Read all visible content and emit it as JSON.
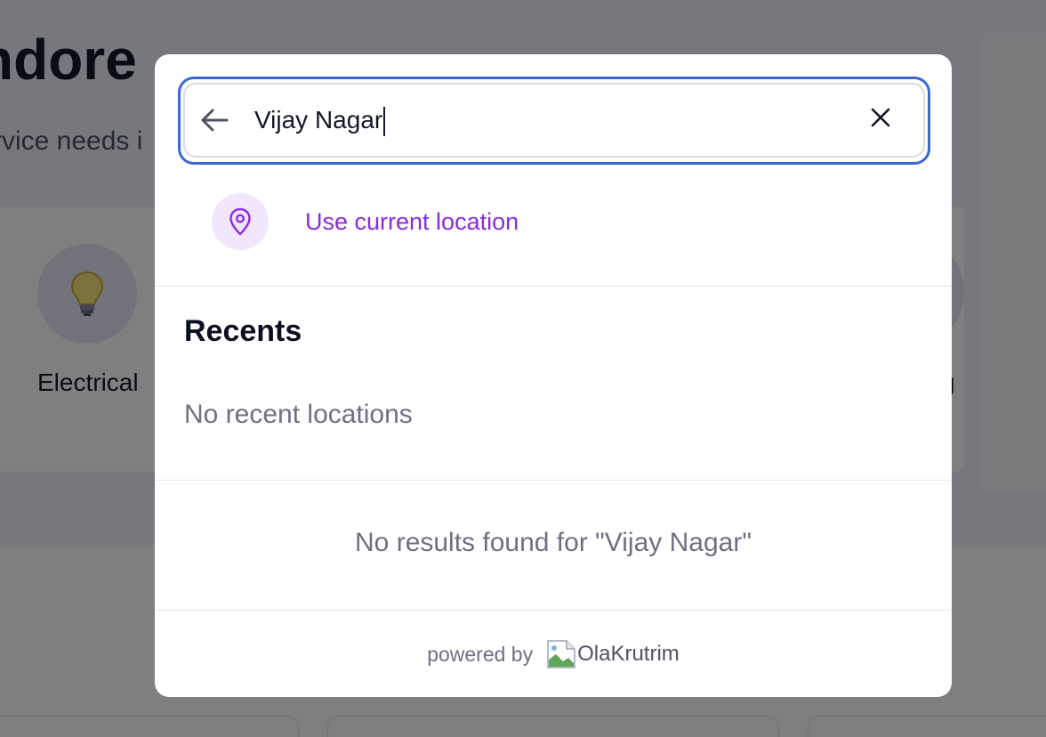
{
  "background": {
    "title": "ndore",
    "subtitle": "rvice needs i",
    "categories": [
      {
        "label": "Electrical",
        "icon": "lightbulb-icon"
      },
      {
        "label": "g"
      }
    ]
  },
  "search": {
    "value": "Vijay Nagar",
    "back_icon": "arrow-left-icon",
    "clear_icon": "close-icon"
  },
  "current_location": {
    "label": "Use current location",
    "icon": "map-pin-icon",
    "color": "#8a2be2"
  },
  "recents": {
    "title": "Recents",
    "empty_text": "No recent locations"
  },
  "results": {
    "empty_text": "No results found for \"Vijay Nagar\""
  },
  "footer": {
    "powered_by": "powered by",
    "brand": "OlaKrutrim"
  },
  "colors": {
    "focus_ring": "#3b67d8",
    "accent": "#8a2be2",
    "overlay": "rgba(0,0,0,0.5)"
  }
}
